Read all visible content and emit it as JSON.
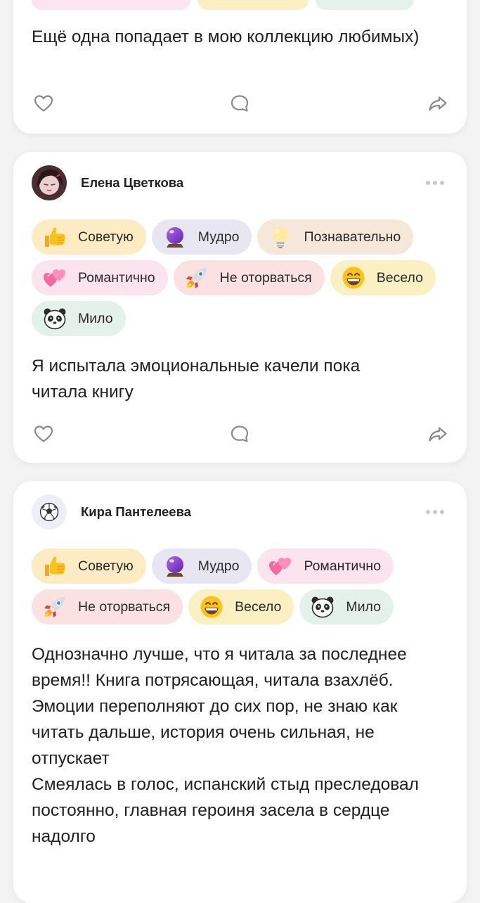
{
  "colors": {
    "background": "#f3f3f4",
    "card": "#ffffff",
    "text": "#1f1f1f",
    "icon": "#8a8a8e",
    "chip_advise": "#fdebc4",
    "chip_wise": "#e9e6f3",
    "chip_cognitive": "#f5e7d9",
    "chip_romantic": "#fbe4ee",
    "chip_unputdownable": "#fbe1e1",
    "chip_fun": "#fbefc4",
    "chip_cute": "#e3f1ea"
  },
  "reviews": [
    {
      "text": "Ещё одна попадает в мою коллекцию любимых)",
      "actions": [
        "heart-icon",
        "comment-icon",
        "share-icon"
      ]
    },
    {
      "author": "Елена Цветкова",
      "avatar": "photo-avatar",
      "tags": [
        {
          "label": "Советую",
          "icon": "thumbs-up-icon"
        },
        {
          "label": "Мудро",
          "icon": "crystal-ball-icon"
        },
        {
          "label": "Познавательно",
          "icon": "light-bulb-icon"
        },
        {
          "label": "Романтично",
          "icon": "two-hearts-icon"
        },
        {
          "label": "Не оторваться",
          "icon": "rocket-icon"
        },
        {
          "label": "Весело",
          "icon": "grinning-face-icon"
        },
        {
          "label": "Мило",
          "icon": "panda-icon"
        }
      ],
      "text": "Я испытала эмоциональные качели пока читала книгу",
      "actions": [
        "heart-icon",
        "comment-icon",
        "share-icon"
      ]
    },
    {
      "author": "Кира Пантелеева",
      "avatar": "soccer-ball-icon",
      "tags": [
        {
          "label": "Советую",
          "icon": "thumbs-up-icon"
        },
        {
          "label": "Мудро",
          "icon": "crystal-ball-icon"
        },
        {
          "label": "Романтично",
          "icon": "two-hearts-icon"
        },
        {
          "label": "Не оторваться",
          "icon": "rocket-icon"
        },
        {
          "label": "Весело",
          "icon": "grinning-face-icon"
        },
        {
          "label": "Мило",
          "icon": "panda-icon"
        }
      ],
      "text": "Однозначно лучше, что я читала за последнее время!! Книга потрясающая, читала взахлёб. Эмоции переполняют до сих пор, не знаю как читать дальше, история очень сильная, не отпускает\nСмеялась в голос, испанский стыд преследовал постоянно, главная героиня засела в сердце надолго"
    }
  ]
}
